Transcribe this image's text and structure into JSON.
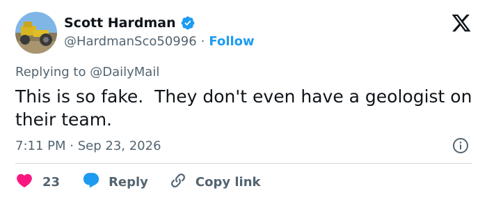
{
  "author": {
    "name": "Scott Hardman",
    "handle": "@HardmanSco50996",
    "follow_label": "Follow",
    "verified": true
  },
  "reply_context": {
    "prefix": "Replying to",
    "target": "@DailyMail"
  },
  "tweet": {
    "text": "This is so fake.  They don't even have a geologist on their team."
  },
  "meta": {
    "time": "7:11 PM",
    "separator": "·",
    "date": "Sep 23, 2026"
  },
  "actions": {
    "like_count": "23",
    "reply_label": "Reply",
    "copy_link_label": "Copy link"
  },
  "icons": {
    "brand": "x-logo-icon",
    "verified": "verified-badge-icon",
    "info": "info-icon",
    "like": "heart-icon",
    "reply": "speech-bubble-icon",
    "copy": "link-icon"
  },
  "colors": {
    "accent": "#1d9bf0",
    "like": "#f91880",
    "text": "#0f1419",
    "muted": "#536471"
  }
}
